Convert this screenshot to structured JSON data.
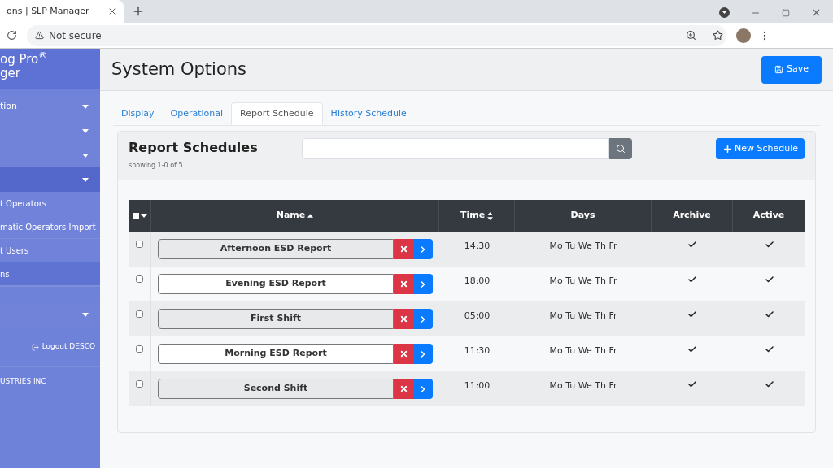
{
  "browser": {
    "tab_title": "ons | SLP Manager",
    "security": "Not secure"
  },
  "sidebar": {
    "logo_lines": [
      "og Pro$^{®}$",
      "ger"
    ],
    "items": [
      {
        "kind": "menu",
        "label": "tion",
        "selected": false
      },
      {
        "kind": "menu",
        "selected": false
      },
      {
        "kind": "menu",
        "selected": false
      },
      {
        "kind": "menu",
        "selected": true
      },
      {
        "kind": "sub",
        "label": "t Operators",
        "selected": false
      },
      {
        "kind": "sub",
        "label": "matic Operators Import",
        "selected": false
      },
      {
        "kind": "sub",
        "label": "t Users",
        "selected": false
      },
      {
        "kind": "sub",
        "label": "ns",
        "selected": true
      },
      {
        "kind": "spacer"
      },
      {
        "kind": "menu",
        "selected": false
      },
      {
        "kind": "logout",
        "label": "Logout DESCO"
      },
      {
        "kind": "company",
        "label": "USTRIES INC"
      }
    ]
  },
  "header": {
    "title": "System Options",
    "save_button": "Save"
  },
  "tabs": [
    {
      "label": "Display",
      "selected": false
    },
    {
      "label": "Operational",
      "selected": false
    },
    {
      "label": "Report Schedule",
      "selected": true
    },
    {
      "label": "History Schedule",
      "selected": false
    }
  ],
  "panel": {
    "title": "Report Schedules",
    "count": "showing 1-0 of 5",
    "new_button": "New Schedule",
    "select_all_checked": false,
    "columns": [
      {
        "label": "Name",
        "kind": "ascending"
      },
      {
        "label": "Time",
        "kind": "sortable"
      },
      {
        "label": "Days",
        "kind": "plain"
      },
      {
        "label": "Archive",
        "kind": "plain"
      },
      {
        "label": "Active",
        "kind": "plain"
      }
    ],
    "rows": [
      {
        "checked": false,
        "name": "Afternoon ESD Report",
        "time": "14:30",
        "days": "Mo Tu We Th Fr",
        "archive": true,
        "active": true
      },
      {
        "checked": false,
        "name": "Evening ESD Report",
        "time": "18:00",
        "days": "Mo Tu We Th Fr",
        "archive": true,
        "active": true
      },
      {
        "checked": false,
        "name": "First Shift",
        "time": "05:00",
        "days": "Mo Tu We Th Fr",
        "archive": true,
        "active": true
      },
      {
        "checked": false,
        "name": "Morning ESD Report",
        "time": "11:30",
        "days": "Mo Tu We Th Fr",
        "archive": true,
        "active": true
      },
      {
        "checked": false,
        "name": "Second Shift",
        "time": "11:00",
        "days": "Mo Tu We Th Fr",
        "archive": true,
        "active": true
      }
    ]
  }
}
